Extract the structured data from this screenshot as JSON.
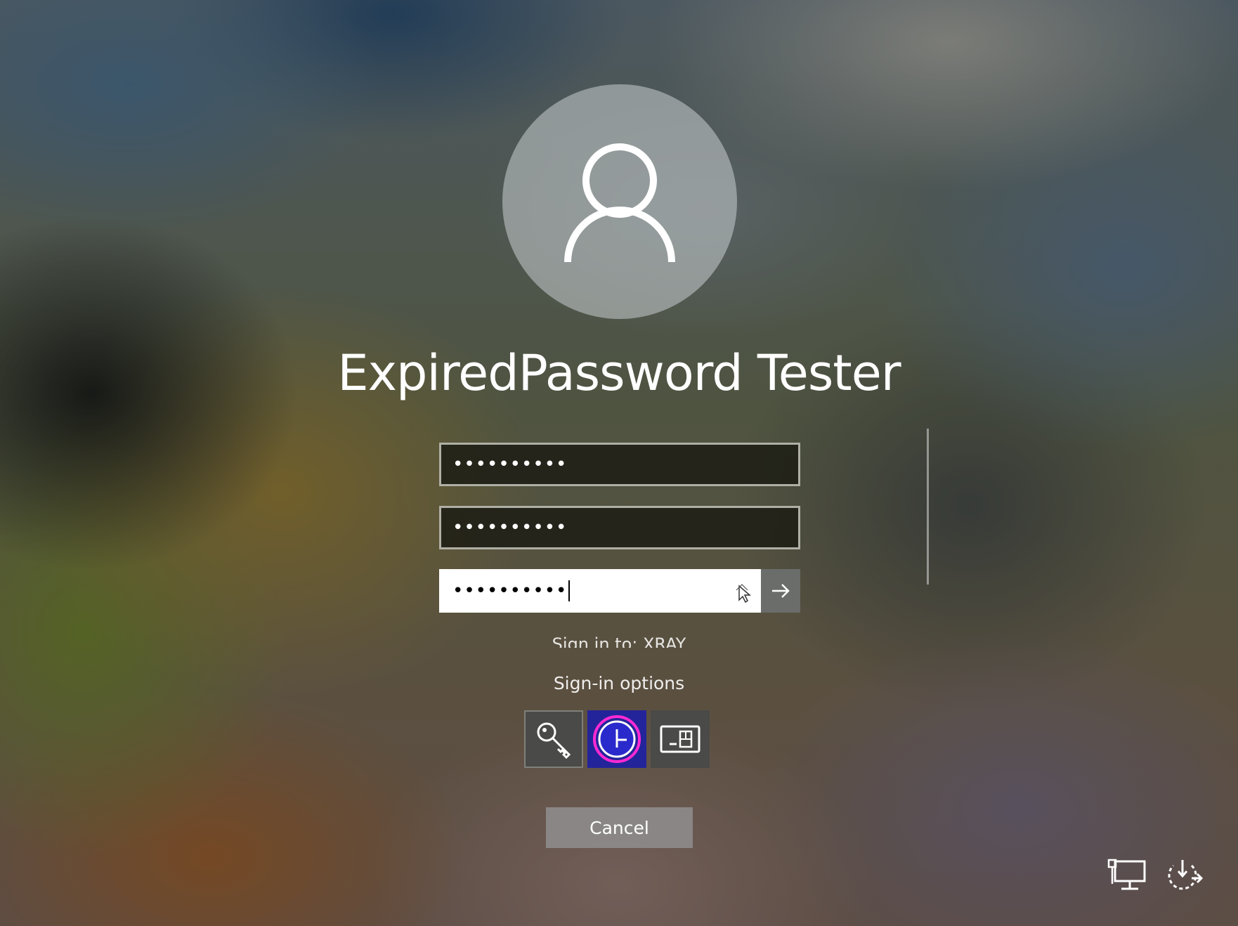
{
  "user": {
    "display_name": "ExpiredPassword Tester",
    "avatar_icon": "user-avatar-icon"
  },
  "fields": [
    {
      "id": "old-password",
      "value": "••••••••••"
    },
    {
      "id": "new-password",
      "value": "••••••••••"
    },
    {
      "id": "confirm-password",
      "value": "••••••••••"
    }
  ],
  "sign_in_to": "Sign in to: XRAY",
  "sign_in_options": {
    "label": "Sign-in options",
    "options": [
      {
        "name": "password",
        "icon": "key-icon"
      },
      {
        "name": "security-key",
        "icon": "clock-icon"
      },
      {
        "name": "smart-card",
        "icon": "smart-card-icon"
      }
    ]
  },
  "cancel_label": "Cancel",
  "corner_icons": [
    "network-icon",
    "power-icon"
  ],
  "colors": {
    "active_field_bg": "#ffffff",
    "inactive_field_bg": "#1c1c14",
    "submit_button_bg": "#6a6d6a",
    "security_key_tile_bg": "#24249a"
  }
}
